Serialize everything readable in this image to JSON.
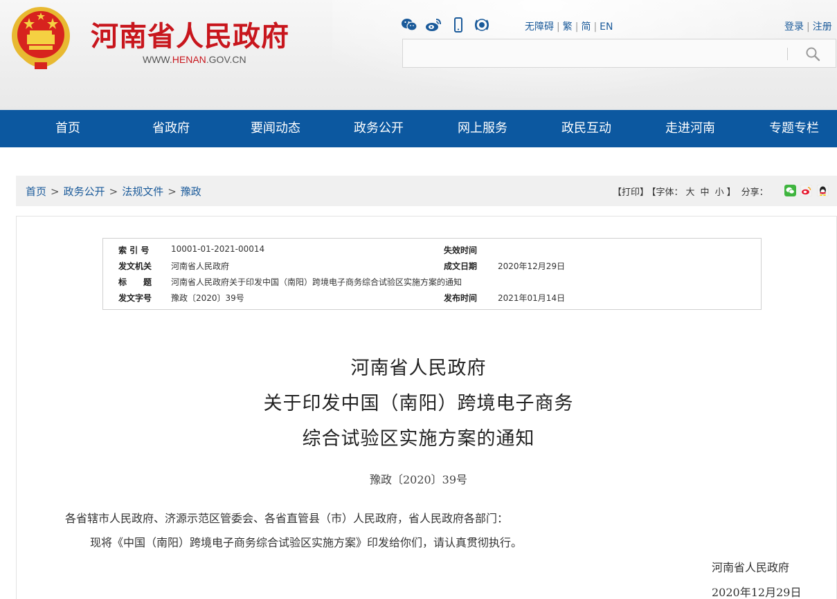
{
  "header": {
    "site_title": "河南省人民政府",
    "url_prefix": "WWW.",
    "url_brand": "HENAN",
    "url_suffix": ".GOV.CN",
    "lang": {
      "accessibility": "无障碍",
      "traditional": "繁",
      "simplified": "简",
      "english": "EN"
    },
    "auth": {
      "login": "登录",
      "register": "注册"
    },
    "search": {
      "placeholder": ""
    },
    "social_icons": [
      "wechat-icon",
      "weibo-icon",
      "mobile-icon",
      "broadcast-icon"
    ]
  },
  "nav": {
    "items": [
      "首页",
      "省政府",
      "要闻动态",
      "政务公开",
      "网上服务",
      "政民互动",
      "走进河南",
      "专题专栏"
    ]
  },
  "breadcrumb": {
    "items": [
      "首页",
      "政务公开",
      "法规文件",
      "豫政"
    ],
    "separator": ">"
  },
  "tools": {
    "print": "【打印】",
    "font_label": "【字体：",
    "font_large": "大",
    "font_medium": "中",
    "font_small": "小",
    "font_close": "】",
    "share": "分享："
  },
  "meta": {
    "index_label": "索 引 号",
    "index_value": "10001-01-2021-00014",
    "expire_label": "失效时间",
    "expire_value": "",
    "issuer_label": "发文机关",
    "issuer_value": "河南省人民政府",
    "created_label": "成文日期",
    "created_value": "2020年12月29日",
    "title_label": "标　　题",
    "title_value": "河南省人民政府关于印发中国（南阳）跨境电子商务综合试验区实施方案的通知",
    "docno_label": "发文字号",
    "docno_value": "豫政〔2020〕39号",
    "published_label": "发布时间",
    "published_value": "2021年01月14日"
  },
  "document": {
    "title_line1": "河南省人民政府",
    "title_line2": "关于印发中国（南阳）跨境电子商务",
    "title_line3": "综合试验区实施方案的通知",
    "doc_number": "豫政〔2020〕39号",
    "salutation": "各省辖市人民政府、济源示范区管委会、各省直管县（市）人民政府，省人民政府各部门：",
    "body": "现将《中国（南阳）跨境电子商务综合试验区实施方案》印发给你们，请认真贯彻执行。",
    "signature": "河南省人民政府",
    "date": "2020年12月29日"
  },
  "colors": {
    "brand_red": "#c8161d",
    "nav_blue": "#0c58a0",
    "link_blue": "#1a5a9a"
  }
}
